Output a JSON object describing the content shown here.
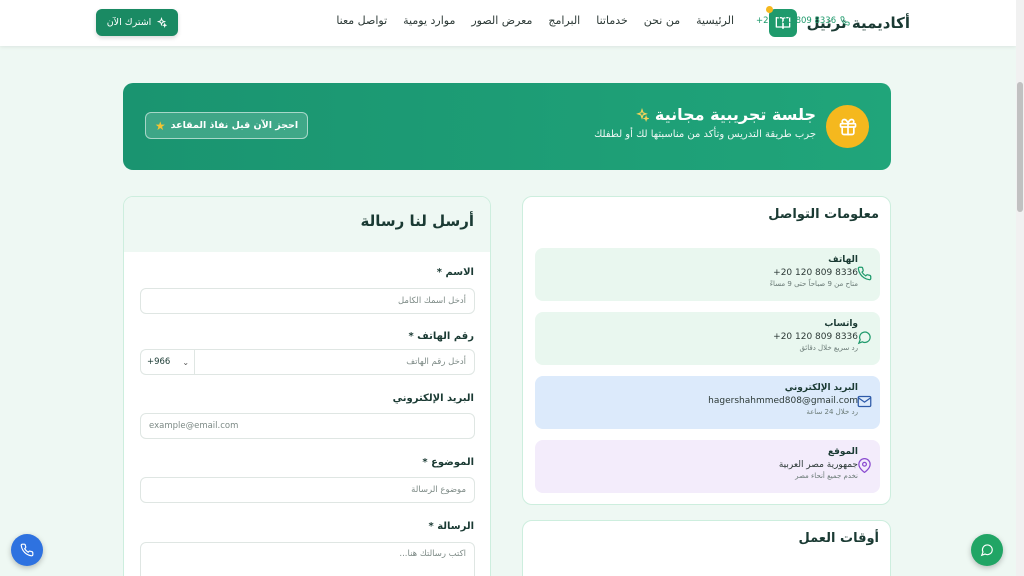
{
  "header": {
    "brand": "أكاديمية ترتيل",
    "nav": [
      "الرئيسية",
      "من نحن",
      "خدماتنا",
      "البرامج",
      "معرض الصور",
      "موارد يومية",
      "تواصل معنا"
    ],
    "phone": "+20 120 809 8336",
    "subscribe_label": "اشترك الآن"
  },
  "banner": {
    "title": "جلسة تجريبية مجانية",
    "subtitle": "جرب طريقة التدريس وتأكد من مناسبتها لك أو لطفلك",
    "button_label": "احجز الآن قبل نفاذ المقاعد"
  },
  "contact_info": {
    "title": "معلومات التواصل",
    "items": [
      {
        "label": "الهاتف",
        "value": "+20 120 809 8336",
        "note": "متاح من 9 صباحاً حتى 9 مساءً"
      },
      {
        "label": "واتساب",
        "value": "+20 120 809 8336",
        "note": "رد سريع خلال دقائق"
      },
      {
        "label": "البريد الإلكتروني",
        "value": "hagershahmmed808@gmail.com",
        "note": "رد خلال 24 ساعة"
      },
      {
        "label": "الموقع",
        "value": "جمهورية مصر العربية",
        "note": "نخدم جميع أنحاء مصر"
      }
    ]
  },
  "work_hours": {
    "title": "أوقات العمل"
  },
  "form": {
    "title": "أرسل لنا رسالة",
    "name_label": "الاسم",
    "name_placeholder": "أدخل اسمك الكامل",
    "phone_label": "رقم الهاتف",
    "phone_placeholder": "أدخل رقم الهاتف",
    "country_code": "+966",
    "email_label": "البريد الإلكتروني",
    "email_placeholder": "example@email.com",
    "subject_label": "الموضوع",
    "subject_placeholder": "موضوع الرسالة",
    "message_label": "الرسالة",
    "message_placeholder": "اكتب رسالتك هنا...",
    "required_mark": "*"
  },
  "colors": {
    "primary": "#1f9a6c",
    "accent": "#f5b81e",
    "call_fab": "#2e72e0",
    "chat_fab": "#21a565"
  }
}
